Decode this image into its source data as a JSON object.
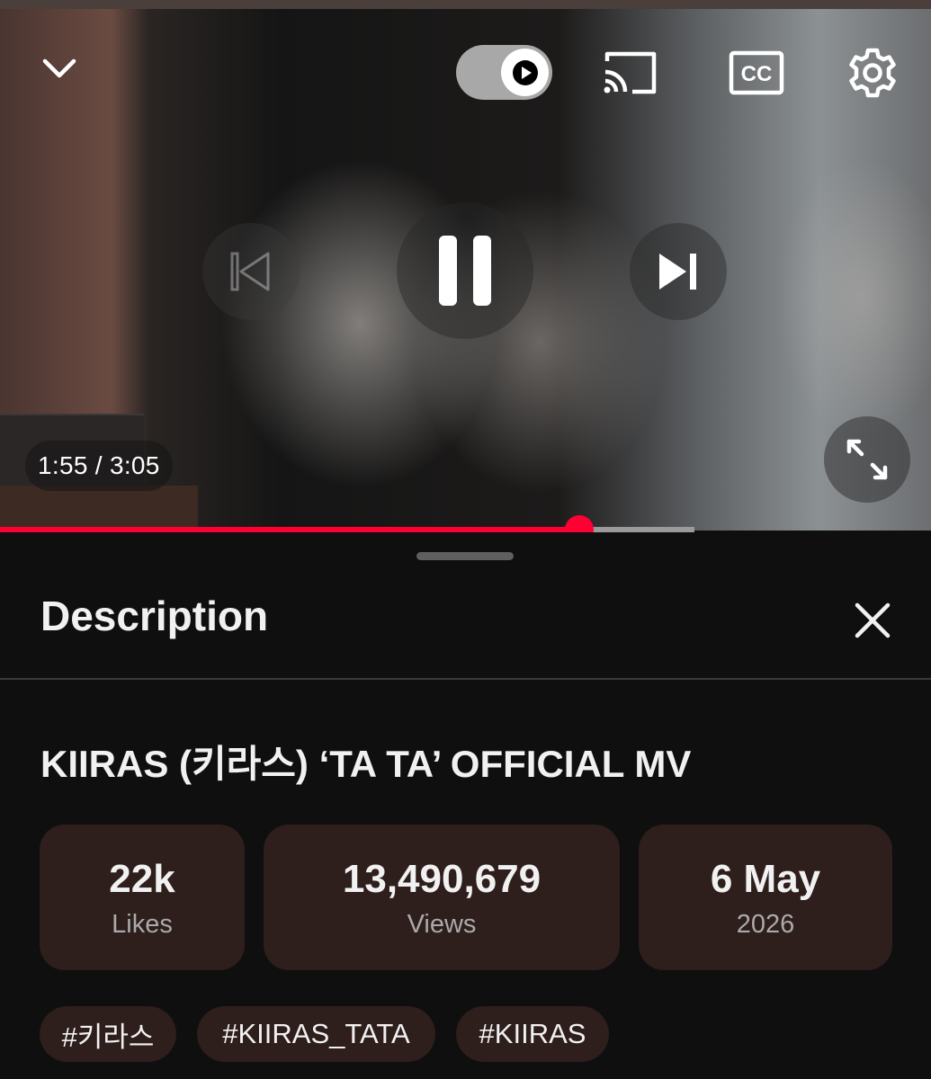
{
  "player": {
    "time_current": "1:55",
    "time_separator": " / ",
    "time_total": "3:05",
    "progress_fraction": 0.622,
    "buffered_fraction": 0.746,
    "icons": {
      "collapse": "chevron-down-icon",
      "autoplay": "autoplay-toggle",
      "cast": "cast-icon",
      "captions": "closed-captions-icon",
      "settings": "gear-icon",
      "previous": "previous-icon",
      "pause": "pause-icon",
      "next": "next-icon",
      "fullscreen": "fullscreen-icon"
    },
    "captions_label": "CC"
  },
  "description": {
    "heading": "Description",
    "video_title": "KIIRAS (키라스) ‘TA TA’ OFFICIAL MV",
    "stats": [
      {
        "value": "22k",
        "label": "Likes"
      },
      {
        "value": "13,490,679",
        "label": "Views"
      },
      {
        "value": "6 May",
        "label": "2026"
      }
    ],
    "tags": [
      "#키라스",
      "#KIIRAS_TATA",
      "#KIIRAS"
    ]
  },
  "colors": {
    "accent_red": "#ff0033",
    "card_bg": "#2e1e1c",
    "sheet_bg": "#0f0f0f"
  }
}
